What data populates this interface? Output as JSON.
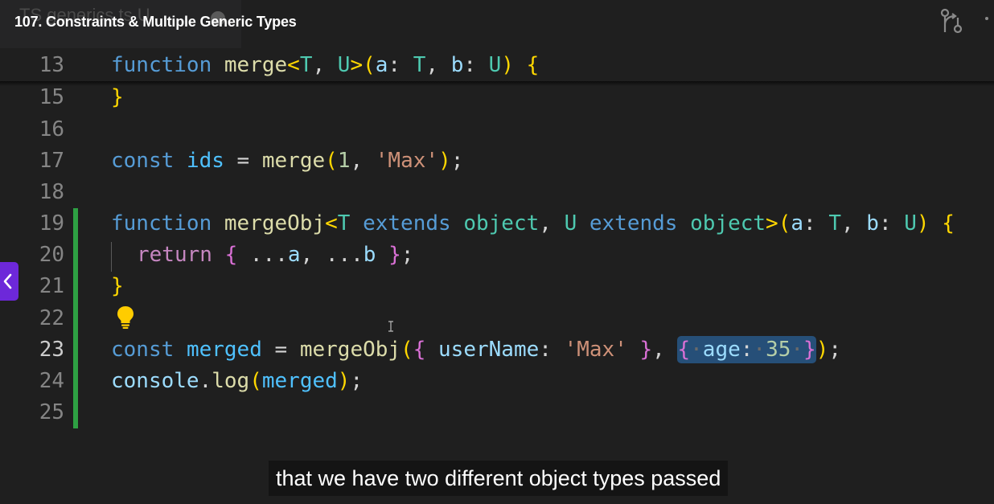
{
  "video": {
    "title": "107. Constraints & Multiple Generic Types"
  },
  "editor": {
    "ghost_tab_label": "TS generics.ts U",
    "lines": {
      "l13": {
        "num": "13"
      },
      "l15": {
        "num": "15"
      },
      "l16": {
        "num": "16"
      },
      "l17": {
        "num": "17"
      },
      "l18": {
        "num": "18"
      },
      "l19": {
        "num": "19"
      },
      "l20": {
        "num": "20"
      },
      "l21": {
        "num": "21"
      },
      "l22": {
        "num": "22"
      },
      "l23": {
        "num": "23"
      },
      "l24": {
        "num": "24"
      },
      "l25": {
        "num": "25"
      }
    },
    "tokens": {
      "function": "function",
      "const": "const",
      "return": "return",
      "extends": "extends",
      "merge": "merge",
      "mergeObj": "mergeObj",
      "T": "T",
      "U": "U",
      "a": "a",
      "b": "b",
      "object": "object",
      "ids": "ids",
      "merged": "merged",
      "console": "console",
      "log": "log",
      "one": "1",
      "max": "'Max'",
      "userName": "userName",
      "age": "age",
      "n35": "35"
    },
    "active_line": "23",
    "selection": "{ age: 35 }"
  },
  "caption": {
    "text": "that we have two different object types passed"
  },
  "icons": [
    "source-control-icon",
    "lightbulb-icon",
    "text-cursor-icon",
    "collapse-panel-icon"
  ],
  "colors": {
    "background": "#1f1f1f",
    "keyword": "#569cd6",
    "function": "#dcdcaa",
    "type": "#4ec9b0",
    "string": "#ce9178",
    "gutter_added": "#2ea043",
    "accent": "#6d28d9"
  }
}
